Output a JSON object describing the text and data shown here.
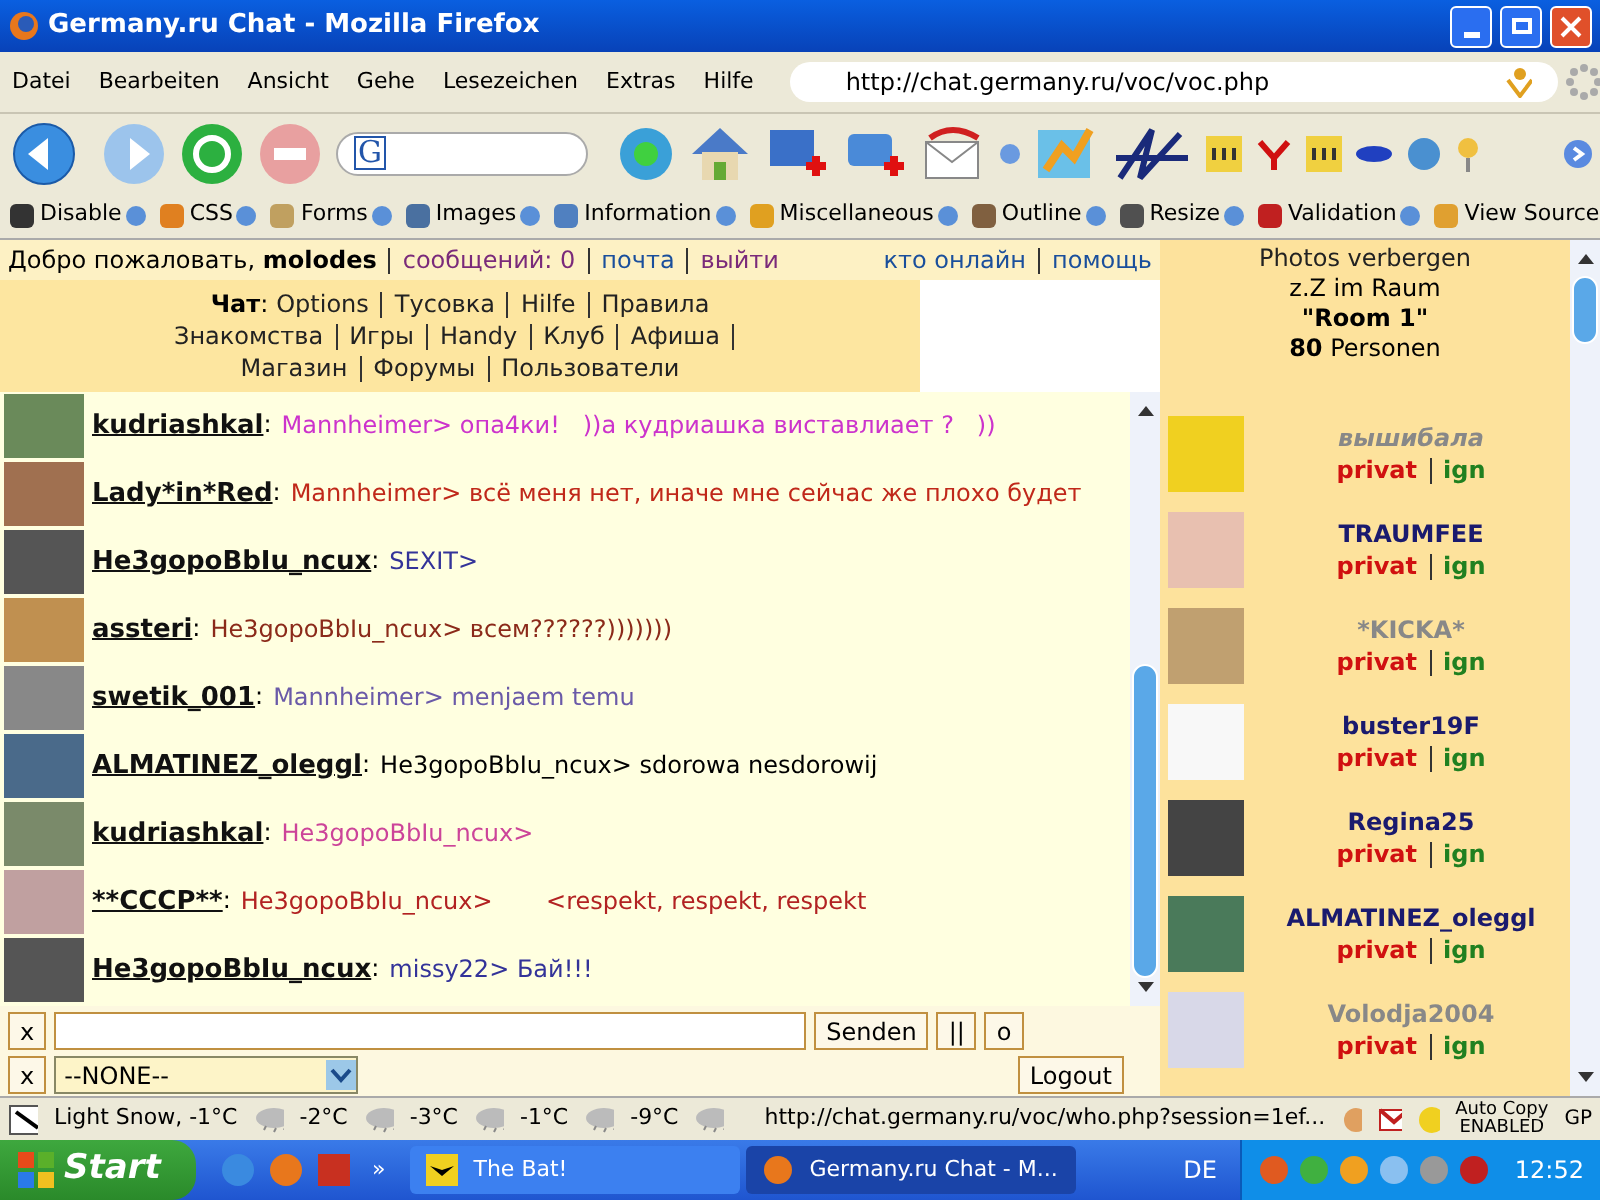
{
  "window": {
    "title": "Germany.ru Chat - Mozilla Firefox"
  },
  "menu": [
    "Datei",
    "Bearbeiten",
    "Ansicht",
    "Gehe",
    "Lesezeichen",
    "Extras",
    "Hilfe"
  ],
  "address": {
    "value": "http://chat.germany.ru/voc/voc.php"
  },
  "search": {
    "value": "G"
  },
  "dev_toolbar": [
    "Disable",
    "CSS",
    "Forms",
    "Images",
    "Information",
    "Miscellaneous",
    "Outline",
    "Resize",
    "Validation",
    "View Source"
  ],
  "top_bar": {
    "welcome": "Добро пожаловать, **molodes**",
    "links": [
      "сообщений: 0",
      "почта",
      "выйти"
    ],
    "right_links": [
      "кто онлайн",
      "помощь"
    ]
  },
  "nav": {
    "label": "**Чат**:",
    "lines": [
      [
        "Options",
        "Тусовка",
        "Hilfe",
        "Правила"
      ],
      [
        "Знакомства",
        "Игры",
        "Handy",
        "Клуб",
        "Афиша"
      ],
      [
        "Магазин",
        "Форумы",
        "Пользователи"
      ]
    ]
  },
  "messages": [
    {
      "user": "kudriashkal",
      "separator": ":",
      "text": "Mannheimer> опа4ки!   ))а кудриашка виставлиает ?   ))",
      "color": "#cc33cc"
    },
    {
      "user": "Lady*in*Red",
      "separator": ":",
      "text": "Mannheimer> всё меня нет, иначе мне сейчас же плохо будет",
      "color": "#c0281a"
    },
    {
      "user": "He3gopoBbIu_ncux",
      "separator": ":",
      "text": "SEXIT>",
      "color": "#333399"
    },
    {
      "user": "assteri",
      "separator": ":",
      "text": "He3gopoBbIu_ncux> всем??????)))))))",
      "color": "#8b2a1a"
    },
    {
      "user": "swetik_001",
      "separator": ":",
      "text": "Mannheimer> menjaem temu",
      "color": "#6a5aa8"
    },
    {
      "user": "ALMATINEZ_oleggl",
      "separator": ":",
      "text": "He3gopoBbIu_ncux> sdorowa nesdorowij",
      "color": "#000000"
    },
    {
      "user": "kudriashkal",
      "separator": ":",
      "text": "He3gopoBbIu_ncux>",
      "color": "#cc4499"
    },
    {
      "user": "**CCCP**",
      "separator": ":",
      "text": "He3gopoBbIu_ncux>       <respekt, respekt, respekt",
      "color": "#b22222"
    },
    {
      "user": "He3gopoBbIu_ncux",
      "separator": ":",
      "text": "missy22> Бай!!!",
      "color": "#333399"
    }
  ],
  "input": {
    "clear": "x",
    "send": "Senden",
    "pause": "||",
    "option": "o"
  },
  "select": {
    "clear": "x",
    "value": "--NONE--",
    "logout": "Logout"
  },
  "room": {
    "toggle": "Photos verbergen",
    "label": "z.Z im Raum",
    "name": "\"Room 1\"",
    "count": "**80** Personen"
  },
  "users": [
    {
      "name": "вышибала",
      "color": "#888888",
      "italic": true,
      "privat": "privat",
      "ign": "ign"
    },
    {
      "name": "TRAUMFEE",
      "color": "#1a1a6e",
      "italic": false,
      "privat": "privat",
      "ign": "ign"
    },
    {
      "name": "*KICKA*",
      "color": "#888888",
      "italic": false,
      "privat": "privat",
      "ign": "ign"
    },
    {
      "name": "buster19F",
      "color": "#1a1a6e",
      "italic": false,
      "privat": "privat",
      "ign": "ign"
    },
    {
      "name": "Regina25",
      "color": "#1a1a6e",
      "italic": false,
      "privat": "privat",
      "ign": "ign"
    },
    {
      "name": "ALMATINEZ_oleggl",
      "color": "#1a1a6e",
      "italic": false,
      "privat": "privat",
      "ign": "ign"
    },
    {
      "name": "Volodja2004",
      "color": "#888888",
      "italic": false,
      "privat": "privat",
      "ign": "ign"
    }
  ],
  "status_bar": {
    "weather": [
      "Light Snow, -1°C",
      "-2°C",
      "-3°C",
      "-1°C",
      "-9°C"
    ],
    "url": "http://chat.germany.ru/voc/who.php?session=1ef...",
    "auto_copy": "Auto Copy",
    "auto_copy_state": "ENABLED",
    "gp": "GP"
  },
  "taskbar": {
    "start": "Start",
    "overflow": "»",
    "tasks": [
      {
        "label": "The Bat!",
        "selected": false
      },
      {
        "label": "Germany.ru Chat - M...",
        "selected": true
      }
    ],
    "language": "DE",
    "clock": "12:52"
  }
}
